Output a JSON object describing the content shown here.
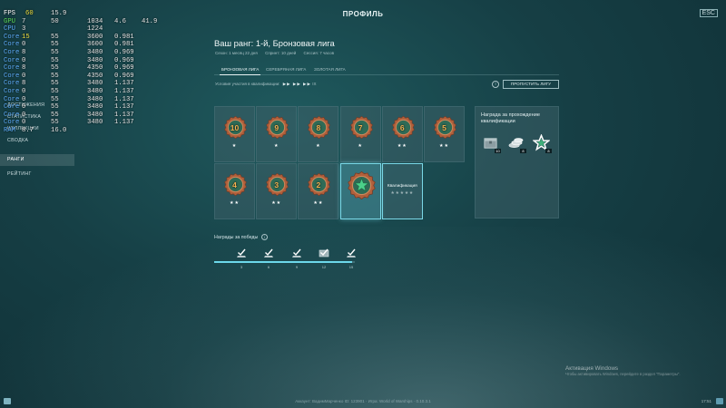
{
  "window": {
    "title": "ПРОФИЛЬ",
    "close_label": "ESC"
  },
  "hw_overlay": [
    {
      "label": "FPS",
      "cols": [
        "",
        "15.9",
        "",
        "",
        ""
      ],
      "extra": "60",
      "note": "fps"
    },
    {
      "label": "GPU",
      "cols": [
        "7",
        "50",
        "1034",
        "4.6",
        "41.9"
      ]
    },
    {
      "label": "CPU",
      "cols": [
        "3",
        "",
        "1224",
        "",
        ""
      ]
    },
    {
      "label": "Core",
      "cols": [
        "15",
        "55",
        "3600",
        "0.981",
        ""
      ]
    },
    {
      "label": "Core",
      "cols": [
        "0",
        "55",
        "3600",
        "0.981",
        ""
      ]
    },
    {
      "label": "Core",
      "cols": [
        "8",
        "55",
        "3480",
        "0.969",
        ""
      ]
    },
    {
      "label": "Core",
      "cols": [
        "0",
        "55",
        "3480",
        "0.969",
        ""
      ]
    },
    {
      "label": "Core",
      "cols": [
        "8",
        "55",
        "4350",
        "0.969",
        ""
      ]
    },
    {
      "label": "Core",
      "cols": [
        "0",
        "55",
        "4350",
        "0.969",
        ""
      ]
    },
    {
      "label": "Core",
      "cols": [
        "8",
        "55",
        "3480",
        "1.137",
        ""
      ]
    },
    {
      "label": "Core",
      "cols": [
        "0",
        "55",
        "3480",
        "1.137",
        ""
      ]
    },
    {
      "label": "Core",
      "cols": [
        "0",
        "55",
        "3480",
        "1.137",
        ""
      ]
    },
    {
      "label": "Core",
      "cols": [
        "0",
        "55",
        "3480",
        "1.137",
        ""
      ]
    },
    {
      "label": "Core",
      "cols": [
        "0",
        "55",
        "3480",
        "1.137",
        ""
      ]
    },
    {
      "label": "Core",
      "cols": [
        "0",
        "55",
        "3480",
        "1.137",
        ""
      ]
    },
    {
      "label": "RAM",
      "cols": [
        "8.7",
        "16.0",
        "",
        "",
        ""
      ]
    }
  ],
  "sidebar": {
    "items": [
      {
        "label": "ДОСТИЖЕНИЯ"
      },
      {
        "label": "СТАТИСТИКА"
      },
      {
        "label": "КОЛЛЕКЦИИ"
      },
      {
        "label": "СВОДКА"
      },
      {
        "label": "РАНГИ",
        "active": true
      },
      {
        "label": "РЕЙТИНГ"
      }
    ]
  },
  "rank": {
    "title": "Ваш ранг: 1-й, Бронзовая лига",
    "season": "Сезон: 1 месяц 22 дня",
    "sprint": "Спринт: 10 дней",
    "session": "Сессия: 7 часов"
  },
  "tabs": [
    {
      "label": "БРОНЗОВАЯ ЛИГА",
      "active": true
    },
    {
      "label": "СЕРЕБРЯНАЯ ЛИГА"
    },
    {
      "label": "ЗОЛОТАЯ ЛИГА"
    }
  ],
  "qualification": {
    "condition_label": "Условия участия в квалификации:",
    "arrows": "▶▶ ▶▶ ▶▶",
    "count": "IX",
    "skip_button": "ПРОПУСТИТЬ ЛИГУ"
  },
  "ranks_row1": [
    {
      "num": "10",
      "stars": "★"
    },
    {
      "num": "9",
      "stars": "★"
    },
    {
      "num": "8",
      "stars": "★"
    },
    {
      "num": "7",
      "stars": "★"
    },
    {
      "num": "6",
      "stars": "★★"
    },
    {
      "num": "5",
      "stars": "★★"
    }
  ],
  "ranks_row2": [
    {
      "num": "4",
      "stars": "★★"
    },
    {
      "num": "3",
      "stars": "★★"
    },
    {
      "num": "2",
      "stars": "★★"
    }
  ],
  "qualification_cell": {
    "label": "Квалификация",
    "stars": "★★★★★"
  },
  "reward_panel": {
    "title": "Награда за прохождение квалификации",
    "items": [
      {
        "icon": "container-icon",
        "count": "10"
      },
      {
        "icon": "coins-icon",
        "count": "8"
      },
      {
        "icon": "star-icon",
        "count": "8"
      }
    ]
  },
  "win_rewards": {
    "title": "Награды за победы",
    "steps": [
      "3",
      "6",
      "9",
      "12",
      "15"
    ]
  },
  "windows_activation": {
    "title": "Активация Windows",
    "subtitle": "Чтобы активировать Windows, перейдите в раздел \"Параметры\"."
  },
  "footer": "Аккаунт: ВадимМарченко   ID: 123901 · Игра: World of Warships · 0.10.3.1",
  "clock": "17:51",
  "colors": {
    "accent": "#6cd8ea",
    "medal_bronze": "#b0603c",
    "medal_green": "#2f6b56"
  }
}
